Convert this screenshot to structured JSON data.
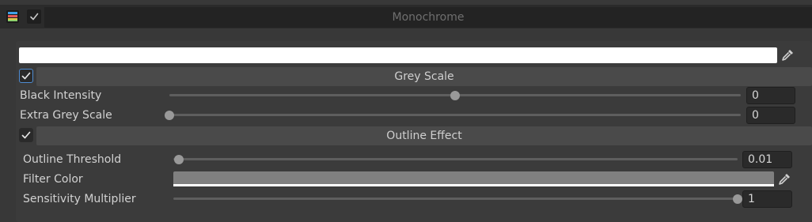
{
  "component": {
    "title": "Monochrome",
    "icon": "palette-icon",
    "enabled": true
  },
  "top_color": {
    "color": "#ffffff",
    "picker_icon": "eyedropper-icon"
  },
  "grey_scale": {
    "label": "Grey Scale",
    "enabled": true,
    "black_intensity": {
      "label": "Black Intensity",
      "value": "0",
      "slider_fraction": 0.5
    },
    "extra_grey_scale": {
      "label": "Extra Grey Scale",
      "value": "0",
      "slider_fraction": 0.0
    }
  },
  "outline_effect": {
    "label": "Outline Effect",
    "enabled": true,
    "outline_threshold": {
      "label": "Outline Threshold",
      "value": "0.01",
      "slider_fraction": 0.01
    },
    "filter_color": {
      "label": "Filter Color",
      "color": "#808080",
      "alpha_bar_color": "#ffffff",
      "picker_icon": "eyedropper-icon"
    },
    "sensitivity_multiplier": {
      "label": "Sensitivity Multiplier",
      "value": "1",
      "slider_fraction": 1.0
    }
  },
  "colors": {
    "accent_focus": "#4f8cd1",
    "check_mark": "#e6e6e6"
  }
}
